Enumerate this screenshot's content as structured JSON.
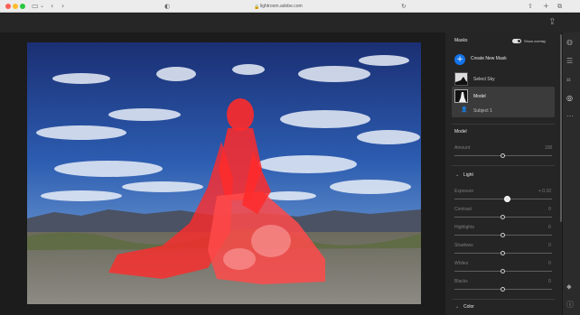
{
  "browser": {
    "url": "lightroom.adobe.com",
    "traffic_lights": [
      "#ff5f57",
      "#febc2e",
      "#28c840"
    ]
  },
  "masks_panel": {
    "title": "Masks",
    "show_overlay_label": "Show overlay",
    "show_overlay_on": true,
    "create_new_mask_label": "Create New Mask",
    "mask_list": [
      {
        "label": "Select Sky",
        "selected": false
      },
      {
        "label": "Model",
        "selected": true,
        "component": "Subject 1"
      }
    ]
  },
  "adjust_panel": {
    "mask_name": "Model",
    "amount": {
      "label": "Amount",
      "value": "100"
    },
    "light_section": {
      "title": "Light",
      "sliders": [
        {
          "label": "Exposure",
          "value": "+ 0.10"
        },
        {
          "label": "Contrast",
          "value": "0"
        },
        {
          "label": "Highlights",
          "value": "0"
        },
        {
          "label": "Shadows",
          "value": "0"
        },
        {
          "label": "Whites",
          "value": "0"
        },
        {
          "label": "Blacks",
          "value": "0"
        }
      ]
    },
    "color_section": {
      "title": "Color"
    }
  },
  "colors": {
    "accent": "#1473e6",
    "mask_overlay": "#ff2020"
  },
  "icons": {
    "share": "share-icon",
    "rail": [
      "edit-icon",
      "sliders-icon",
      "crop-icon",
      "masking-icon",
      "more-icon",
      "tag-icon",
      "help-icon"
    ]
  }
}
